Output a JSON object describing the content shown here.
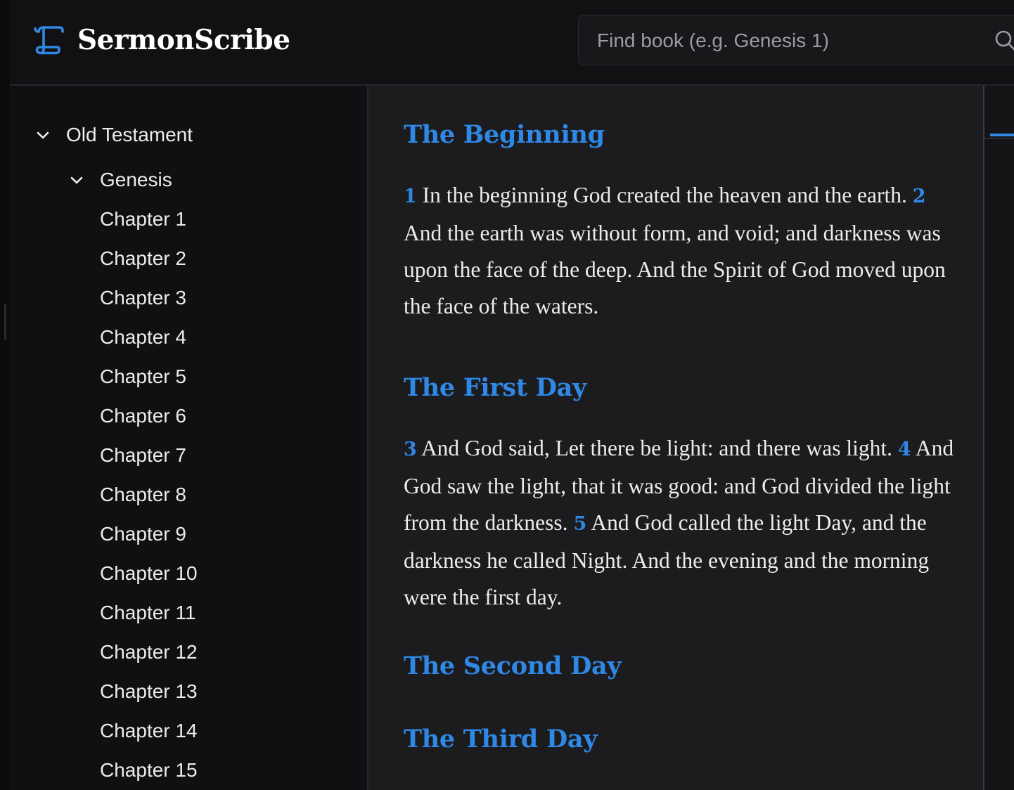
{
  "app": {
    "name": "SermonScribe",
    "logo_icon": "scroll-icon",
    "accent_color": "#2f88e6"
  },
  "search": {
    "placeholder": "Find book (e.g. Genesis 1)",
    "value": "",
    "icon": "search-icon"
  },
  "sidebar": {
    "testament": {
      "label": "Old Testament",
      "expanded": true
    },
    "book": {
      "label": "Genesis",
      "expanded": true
    },
    "chapters": [
      "Chapter 1",
      "Chapter 2",
      "Chapter 3",
      "Chapter 4",
      "Chapter 5",
      "Chapter 6",
      "Chapter 7",
      "Chapter 8",
      "Chapter 9",
      "Chapter 10",
      "Chapter 11",
      "Chapter 12",
      "Chapter 13",
      "Chapter 14",
      "Chapter 15"
    ]
  },
  "content": {
    "sections": [
      {
        "title": "The Beginning",
        "verses": [
          {
            "num": "1",
            "text": "In the beginning God created the heaven and the earth."
          },
          {
            "num": "2",
            "text": "And the earth was without form, and void; and darkness was upon the face of the deep. And the Spirit of God moved upon the face of the waters."
          }
        ]
      },
      {
        "title": "The First Day",
        "verses": [
          {
            "num": "3",
            "text": "And God said, Let there be light: and there was light."
          },
          {
            "num": "4",
            "text": "And God saw the light, that it was good: and God divided the light from the darkness."
          },
          {
            "num": "5",
            "text": "And God called the light Day, and the darkness he called Night. And the evening and the morning were the first day."
          }
        ]
      },
      {
        "title": "The Second Day",
        "verses": []
      },
      {
        "title": "The Third Day",
        "verses": []
      }
    ]
  }
}
